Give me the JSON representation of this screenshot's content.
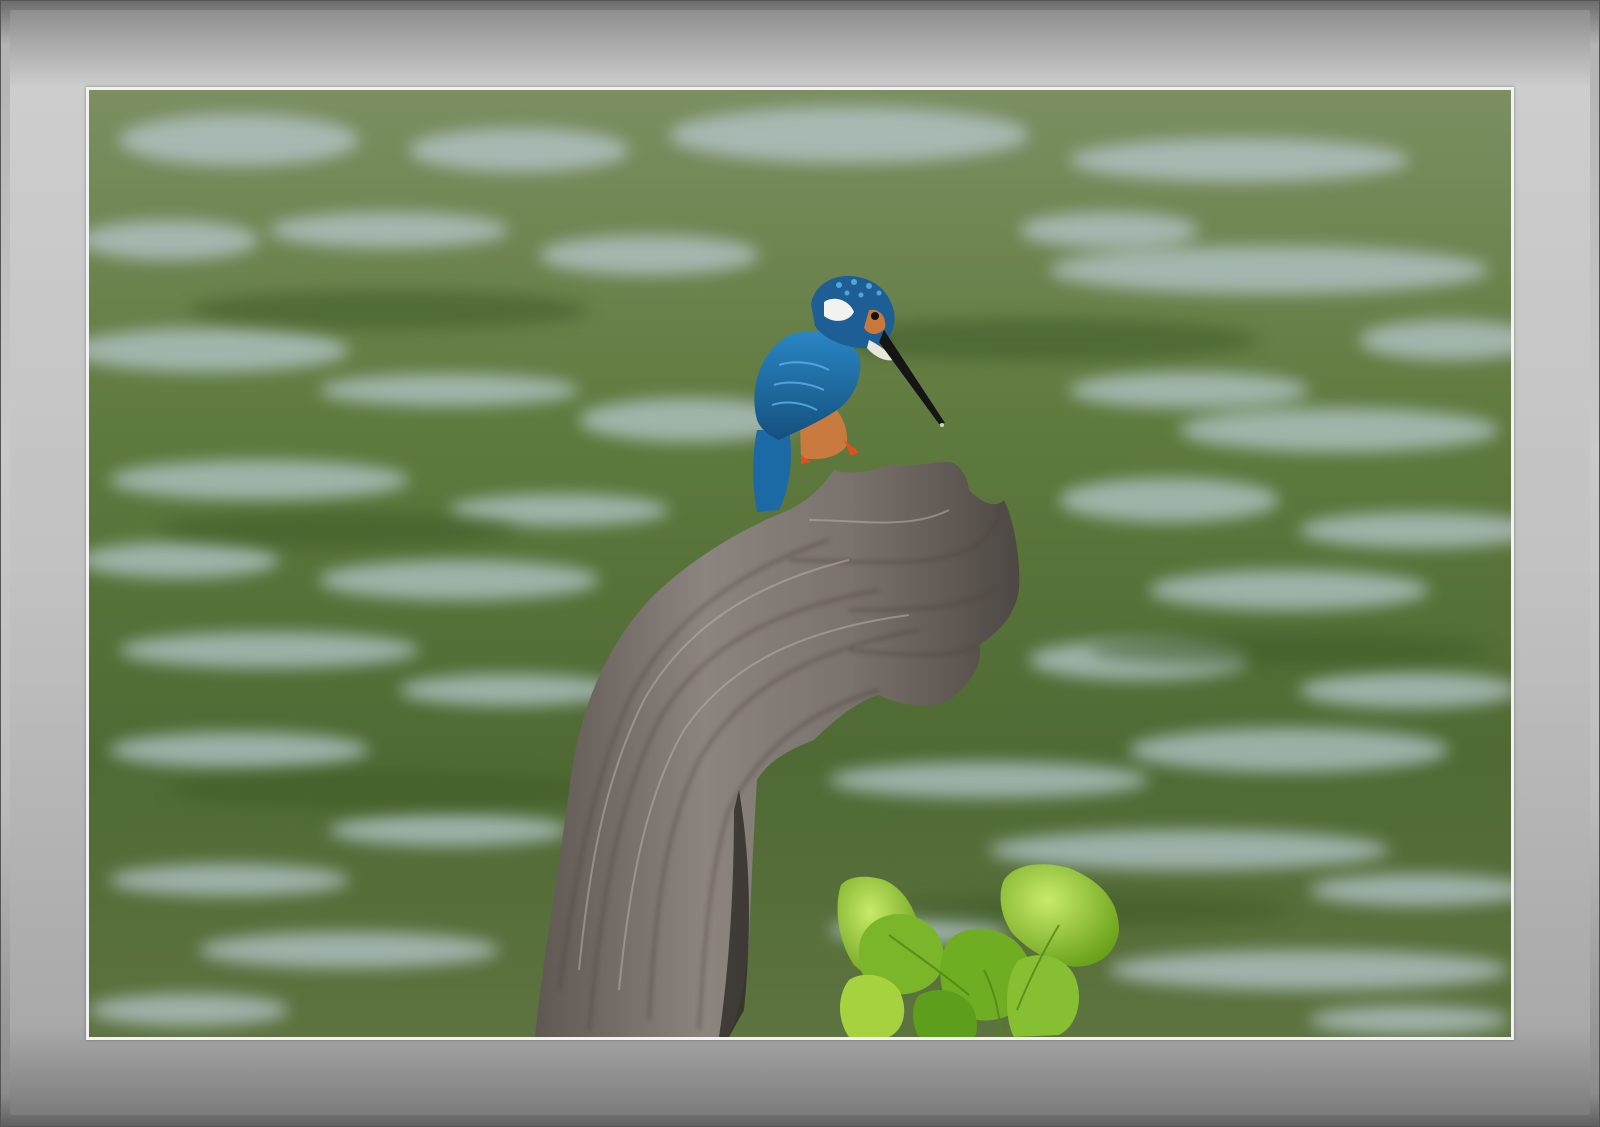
{
  "image": {
    "subject": "kingfisher",
    "perch": "driftwood",
    "foreground": "green-leaves"
  },
  "colors": {
    "frame": "#c2c2c2",
    "water": "#5f7a44",
    "water_highlight": "#aebfc8",
    "wood": "#7d7570",
    "bird_blue": "#1f6fa8",
    "bird_orange": "#c97a3e",
    "leaf": "#9ccc2a"
  }
}
